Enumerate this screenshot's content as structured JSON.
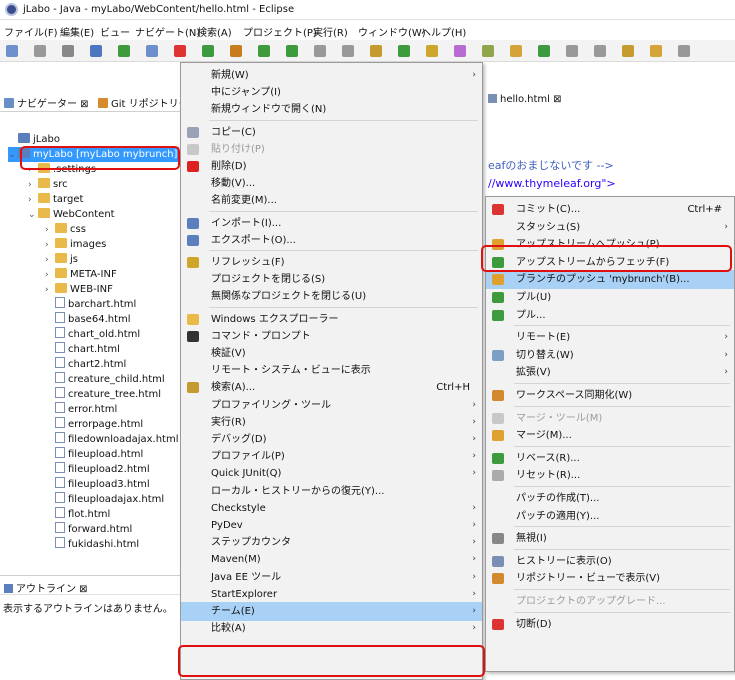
{
  "window": {
    "title": "jLabo - Java - myLabo/WebContent/hello.html - Eclipse"
  },
  "menubar": [
    "ファイル(F)",
    "編集(E)",
    "ビュー",
    "ナビゲート(N)",
    "検索(A)",
    "プロジェクト(P)",
    "実行(R)",
    "ウィンドウ(W)",
    "ヘルプ(H)"
  ],
  "left_tabs": {
    "navigator": "ナビゲーター ⊠",
    "git": "Git リポジトリー"
  },
  "tree": [
    {
      "label": "jLabo",
      "kind": "project",
      "indent": 0
    },
    {
      "label": "myLabo [myLabo mybrunch]",
      "kind": "project-selected",
      "indent": 0
    },
    {
      "label": ".settings",
      "kind": "folder",
      "indent": 1
    },
    {
      "label": "src",
      "kind": "folder",
      "indent": 1
    },
    {
      "label": "target",
      "kind": "folder",
      "indent": 1
    },
    {
      "label": "WebContent",
      "kind": "folder-open",
      "indent": 1
    },
    {
      "label": "css",
      "kind": "folder",
      "indent": 2
    },
    {
      "label": "images",
      "kind": "folder",
      "indent": 2
    },
    {
      "label": "js",
      "kind": "folder",
      "indent": 2
    },
    {
      "label": "META-INF",
      "kind": "folder",
      "indent": 2
    },
    {
      "label": "WEB-INF",
      "kind": "folder",
      "indent": 2
    },
    {
      "label": "barchart.html",
      "kind": "file",
      "indent": 2
    },
    {
      "label": "base64.html",
      "kind": "file",
      "indent": 2
    },
    {
      "label": "chart_old.html",
      "kind": "file",
      "indent": 2
    },
    {
      "label": "chart.html",
      "kind": "file",
      "indent": 2
    },
    {
      "label": "chart2.html",
      "kind": "file",
      "indent": 2
    },
    {
      "label": "creature_child.html",
      "kind": "file",
      "indent": 2
    },
    {
      "label": "creature_tree.html",
      "kind": "file",
      "indent": 2
    },
    {
      "label": "error.html",
      "kind": "file",
      "indent": 2
    },
    {
      "label": "errorpage.html",
      "kind": "file",
      "indent": 2
    },
    {
      "label": "filedownloadajax.html",
      "kind": "file",
      "indent": 2
    },
    {
      "label": "fileupload.html",
      "kind": "file",
      "indent": 2
    },
    {
      "label": "fileupload2.html",
      "kind": "file",
      "indent": 2
    },
    {
      "label": "fileupload3.html",
      "kind": "file",
      "indent": 2
    },
    {
      "label": "fileuploadajax.html",
      "kind": "file",
      "indent": 2
    },
    {
      "label": "flot.html",
      "kind": "file",
      "indent": 2
    },
    {
      "label": "forward.html",
      "kind": "file",
      "indent": 2
    },
    {
      "label": "fukidashi.html",
      "kind": "file",
      "indent": 2
    }
  ],
  "outline": {
    "tab": "アウトライン ⊠",
    "message": "表示するアウトラインはありません。"
  },
  "editor": {
    "tab": "hello.html ⊠",
    "line1": "eafのおまじないです -->",
    "line2": "//www.thymeleaf.org\">"
  },
  "context_menu": [
    {
      "label": "新規(W)",
      "arrow": true
    },
    {
      "label": "中にジャンプ(I)"
    },
    {
      "label": "新規ウィンドウで開く(N)"
    },
    {
      "sep": true
    },
    {
      "label": "コピー(C)",
      "icon": "copy-icon"
    },
    {
      "label": "貼り付け(P)",
      "icon": "paste-icon",
      "disabled": true
    },
    {
      "label": "削除(D)",
      "icon": "delete-icon"
    },
    {
      "label": "移動(V)..."
    },
    {
      "label": "名前変更(M)..."
    },
    {
      "sep": true
    },
    {
      "label": "インポート(I)...",
      "icon": "import-icon"
    },
    {
      "label": "エクスポート(O)...",
      "icon": "export-icon"
    },
    {
      "sep": true
    },
    {
      "label": "リフレッシュ(F)",
      "icon": "refresh-icon"
    },
    {
      "label": "プロジェクトを閉じる(S)"
    },
    {
      "label": "無関係なプロジェクトを閉じる(U)"
    },
    {
      "sep": true
    },
    {
      "label": "Windows エクスプローラー",
      "icon": "explorer-icon"
    },
    {
      "label": "コマンド・プロンプト",
      "icon": "console-icon"
    },
    {
      "label": "検証(V)"
    },
    {
      "label": "リモート・システム・ビューに表示"
    },
    {
      "label": "検索(A)...",
      "icon": "search-icon",
      "shortcut": "Ctrl+H"
    },
    {
      "label": "プロファイリング・ツール",
      "arrow": true
    },
    {
      "label": "実行(R)",
      "arrow": true
    },
    {
      "label": "デバッグ(D)",
      "arrow": true
    },
    {
      "label": "プロファイル(P)",
      "arrow": true
    },
    {
      "label": "Quick JUnit(Q)",
      "arrow": true
    },
    {
      "label": "ローカル・ヒストリーからの復元(Y)..."
    },
    {
      "label": "Checkstyle",
      "arrow": true
    },
    {
      "label": "PyDev",
      "arrow": true
    },
    {
      "label": "ステップカウンタ",
      "arrow": true
    },
    {
      "label": "Maven(M)",
      "arrow": true
    },
    {
      "label": "Java EE ツール",
      "arrow": true
    },
    {
      "label": "StartExplorer",
      "arrow": true
    },
    {
      "label": "チーム(E)",
      "arrow": true,
      "highlighted": true
    },
    {
      "label": "比較(A)",
      "arrow": true
    }
  ],
  "submenu": [
    {
      "label": "コミット(C)...",
      "icon": "commit-icon",
      "shortcut": "Ctrl+#"
    },
    {
      "label": "スタッシュ(S)",
      "arrow": true
    },
    {
      "label": "アップストリームへプッシュ(P)",
      "icon": "push-icon"
    },
    {
      "label": "アップストリームからフェッチ(F)",
      "icon": "fetch-icon"
    },
    {
      "label": "ブランチのプッシュ 'mybrunch'(B)...",
      "icon": "push-branch-icon",
      "highlighted": true
    },
    {
      "label": "プル(U)",
      "icon": "pull-icon"
    },
    {
      "label": "プル...",
      "icon": "pull-icon"
    },
    {
      "sep": true
    },
    {
      "label": "リモート(E)",
      "arrow": true
    },
    {
      "label": "切り替え(W)",
      "icon": "switch-icon",
      "arrow": true
    },
    {
      "label": "拡張(V)",
      "arrow": true
    },
    {
      "sep": true
    },
    {
      "label": "ワークスペース同期化(W)",
      "icon": "sync-icon"
    },
    {
      "sep": true
    },
    {
      "label": "マージ・ツール(M)",
      "icon": "merge-tool-icon",
      "disabled": true
    },
    {
      "label": "マージ(M)...",
      "icon": "merge-icon"
    },
    {
      "sep": true
    },
    {
      "label": "リベース(R)...",
      "icon": "rebase-icon"
    },
    {
      "label": "リセット(R)...",
      "icon": "reset-icon"
    },
    {
      "sep": true
    },
    {
      "label": "パッチの作成(T)..."
    },
    {
      "label": "パッチの適用(Y)..."
    },
    {
      "sep": true
    },
    {
      "label": "無視(I)",
      "icon": "ignore-icon"
    },
    {
      "sep": true
    },
    {
      "label": "ヒストリーに表示(O)",
      "icon": "history-icon"
    },
    {
      "label": "リポジトリー・ビューで表示(V)",
      "icon": "repo-icon"
    },
    {
      "sep": true
    },
    {
      "label": "プロジェクトのアップグレード...",
      "disabled": true
    },
    {
      "sep": true
    },
    {
      "label": "切断(D)",
      "icon": "disconnect-icon"
    }
  ],
  "colors": {
    "highlight": "#a9d0f5",
    "annotation": "#e01010",
    "selection": "#3399ff"
  }
}
